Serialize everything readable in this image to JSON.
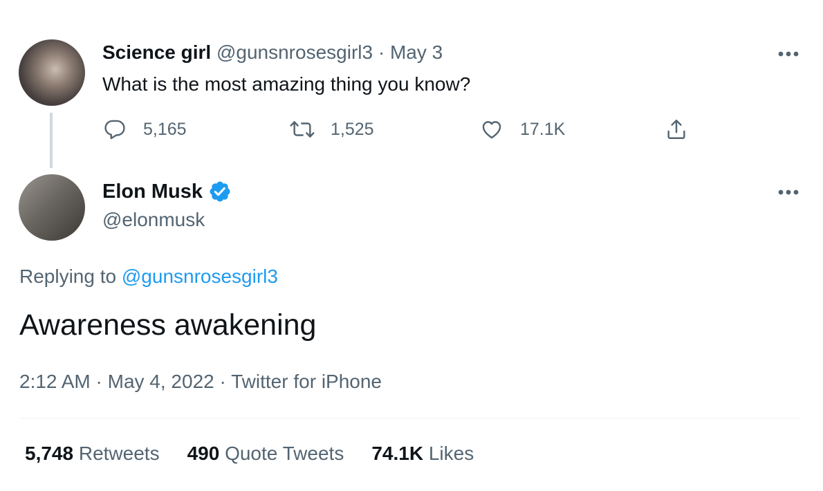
{
  "parent_tweet": {
    "display_name": "Science girl",
    "handle": "@gunsnrosesgirl3",
    "separator": "·",
    "date": "May 3",
    "text": "What is the most amazing thing you know?",
    "actions": {
      "replies": "5,165",
      "retweets": "1,525",
      "likes": "17.1K"
    }
  },
  "reply_tweet": {
    "display_name": "Elon Musk",
    "handle": "@elonmusk",
    "verified": true,
    "replying_to_prefix": "Replying to ",
    "replying_to_handle": "@gunsnrosesgirl3",
    "text": "Awareness awakening",
    "time": "2:12 AM",
    "sep1": " · ",
    "date": "May 4, 2022",
    "sep2": " · ",
    "source": "Twitter for iPhone"
  },
  "stats": {
    "retweets_count": "5,748",
    "retweets_label": "Retweets",
    "quote_tweets_count": "490",
    "quote_tweets_label": "Quote Tweets",
    "likes_count": "74.1K",
    "likes_label": "Likes"
  },
  "colors": {
    "text_primary": "#0f1419",
    "text_secondary": "#536471",
    "link": "#1d9bf0",
    "verified": "#1d9bf0",
    "divider": "#eff3f4",
    "thread_line": "#cfd9de"
  },
  "icons": {
    "reply": "speech-bubble-icon",
    "retweet": "retweet-arrows-icon",
    "like": "heart-icon",
    "share": "share-upload-icon",
    "more": "more-dots-icon",
    "verified": "verified-badge-icon"
  }
}
